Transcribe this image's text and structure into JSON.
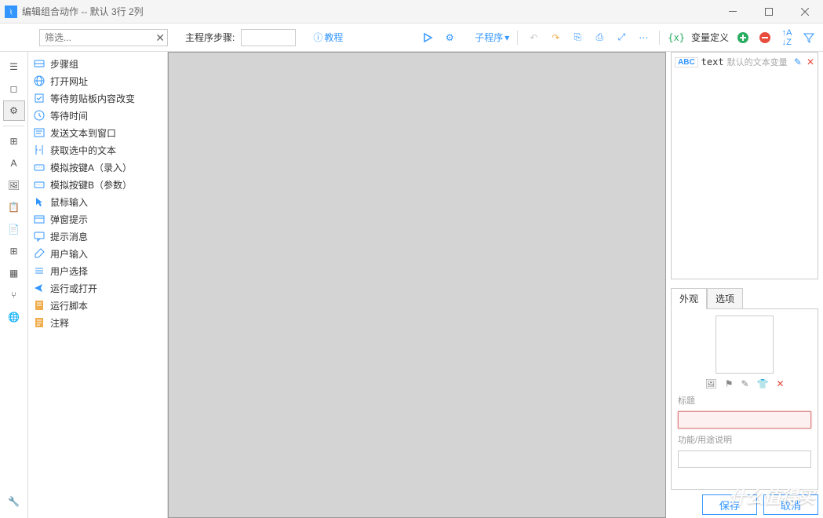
{
  "window": {
    "title": "编辑组合动作 -- 默认 3行 2列"
  },
  "toolbar": {
    "filter_placeholder": "筛选...",
    "main_steps_label": "主程序步骤:",
    "tutorial_label": "教程",
    "subroutine_label": "子程序",
    "var_def_label": "变量定义"
  },
  "actions": [
    {
      "id": "group",
      "label": "步骤组",
      "color": "#3396ff"
    },
    {
      "id": "open-url",
      "label": "打开网址",
      "color": "#3396ff"
    },
    {
      "id": "wait-clipboard",
      "label": "等待剪贴板内容改变",
      "color": "#3396ff"
    },
    {
      "id": "wait-time",
      "label": "等待时间",
      "color": "#3396ff"
    },
    {
      "id": "send-text",
      "label": "发送文本到窗口",
      "color": "#3396ff"
    },
    {
      "id": "get-selected",
      "label": "获取选中的文本",
      "color": "#3396ff"
    },
    {
      "id": "key-a",
      "label": "模拟按键A（录入）",
      "color": "#3396ff"
    },
    {
      "id": "key-b",
      "label": "模拟按键B（参数）",
      "color": "#3396ff"
    },
    {
      "id": "mouse",
      "label": "鼠标输入",
      "color": "#3396ff"
    },
    {
      "id": "popup",
      "label": "弹窗提示",
      "color": "#3396ff"
    },
    {
      "id": "message",
      "label": "提示消息",
      "color": "#3396ff"
    },
    {
      "id": "user-input",
      "label": "用户输入",
      "color": "#3396ff"
    },
    {
      "id": "user-select",
      "label": "用户选择",
      "color": "#3396ff"
    },
    {
      "id": "run-open",
      "label": "运行或打开",
      "color": "#3396ff"
    },
    {
      "id": "run-script",
      "label": "运行脚本",
      "color": "#f0ad4e"
    },
    {
      "id": "comment",
      "label": "注释",
      "color": "#f0ad4e"
    }
  ],
  "variables": [
    {
      "type": "ABC",
      "name": "text",
      "desc": "默认的文本变量"
    }
  ],
  "props": {
    "tab_appearance": "外观",
    "tab_options": "选项",
    "title_label": "标题",
    "desc_label": "功能/用途说明"
  },
  "buttons": {
    "ok": "保存",
    "cancel": "取消"
  },
  "watermark": "什么值得买",
  "colors": {
    "accent": "#3396ff",
    "green": "#27ae60",
    "red": "#e74c3c",
    "orange": "#f0ad4e"
  }
}
